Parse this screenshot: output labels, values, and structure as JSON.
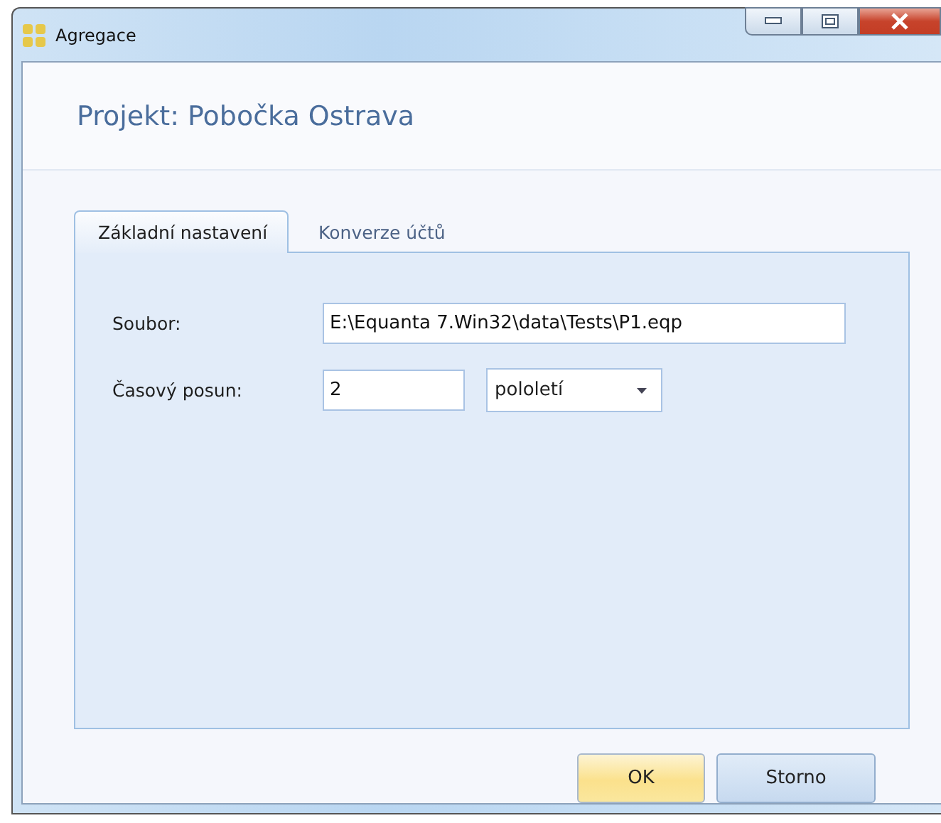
{
  "window": {
    "title": "Agregace"
  },
  "header": {
    "title": "Projekt: Pobočka Ostrava"
  },
  "tabs": [
    {
      "label": "Základní nastavení",
      "selected": true
    },
    {
      "label": "Konverze účtů",
      "selected": false
    }
  ],
  "fields": [
    {
      "label": "Soubor:",
      "value": "E:\\Equanta 7.Win32\\data\\Tests\\P1.eqp"
    },
    {
      "label": "Časový posun:",
      "value": "2",
      "unit": "pololetí"
    }
  ],
  "buttons": [
    {
      "label": "OK",
      "default": true
    },
    {
      "label": "Storno",
      "default": false
    }
  ]
}
